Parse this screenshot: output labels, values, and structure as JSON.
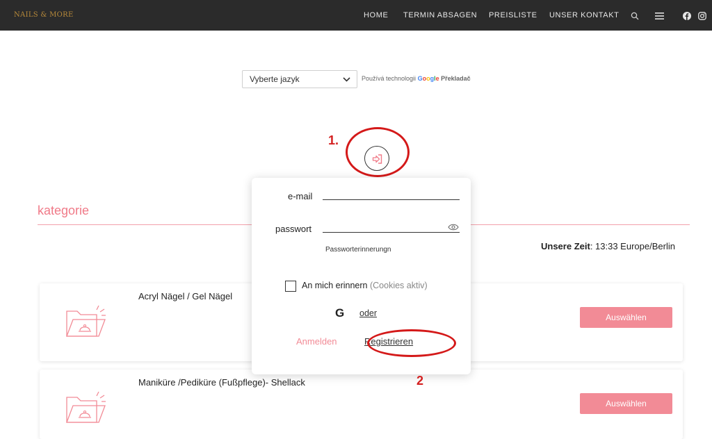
{
  "header": {
    "logo": "NAILS & MORE",
    "nav": [
      {
        "label": "HOME"
      },
      {
        "label": "TERMIN ABSAGEN"
      },
      {
        "label": "PREISLISTE"
      },
      {
        "label": "UNSER KONTAKT"
      }
    ],
    "icons": [
      "search-icon",
      "menu-icon",
      "facebook-icon",
      "instagram-icon"
    ]
  },
  "translate": {
    "select_value": "Vyberte jazyk",
    "powered_prefix": "Používá technologii",
    "google": [
      "G",
      "o",
      "o",
      "g",
      "l",
      "e"
    ],
    "product": "Překladač"
  },
  "annotations": {
    "step1": "1.",
    "step2": "2"
  },
  "category": {
    "title": "kategorie",
    "time_label": "Unsere Zeit",
    "time_value": ": 13:33 Europe/Berlin"
  },
  "cards": [
    {
      "name": "Acryl Nägel / Gel Nägel",
      "button": "Auswählen"
    },
    {
      "name": "Maniküre /Pediküre (Fußpflege)- Shellack",
      "button": "Auswählen"
    }
  ],
  "login": {
    "email_label": "e-mail",
    "password_label": "passwort",
    "forgot": "Passworterinnerungn",
    "remember": "An mich erinnern",
    "remember_note": "(Cookies aktiv)",
    "google_letter": "G",
    "oder": "oder",
    "login_button": "Anmelden",
    "register_button": "Registrieren"
  },
  "colors": {
    "topbar": "#2b2b2b",
    "accent": "#f28b96",
    "annotation": "#d41919"
  }
}
